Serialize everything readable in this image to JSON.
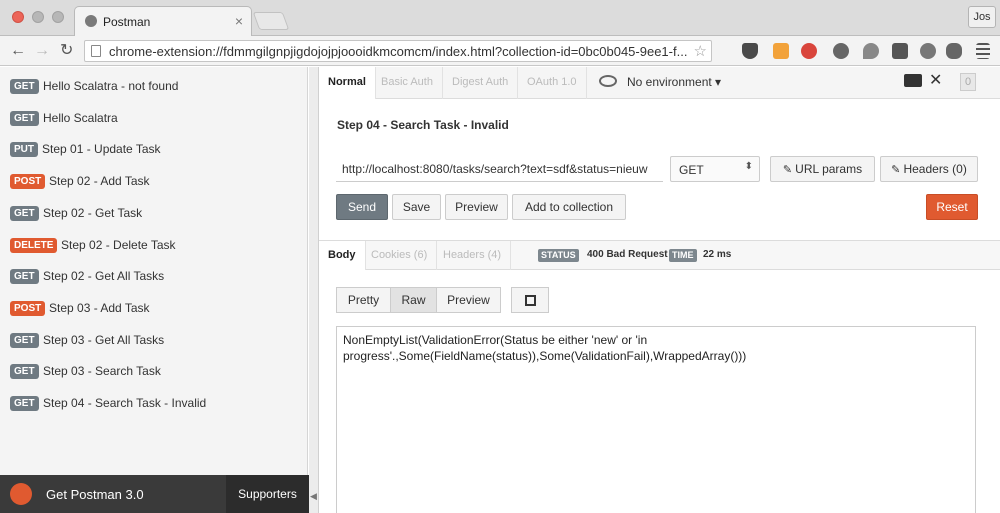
{
  "browser": {
    "tab_title": "Postman",
    "tab_close": "×",
    "profile": "Jos",
    "back": "←",
    "forward": "→",
    "reload": "↻",
    "url": "chrome-extension://fdmmgilgnpjigdojojpjoooidkmcomcm/index.html?collection-id=0bc0b045-9ee1-f...",
    "star": "☆",
    "extensions": [
      "pocket-icon",
      "extension-icon",
      "adblock-icon",
      "opera-icon",
      "location-icon",
      "angular-icon",
      "globe-icon",
      "twitter-icon",
      "menu-icon"
    ]
  },
  "sidebar": {
    "items": [
      {
        "method": "GET",
        "name": "Hello Scalatra - not found"
      },
      {
        "method": "GET",
        "name": "Hello Scalatra"
      },
      {
        "method": "PUT",
        "name": "Step 01 - Update Task"
      },
      {
        "method": "POST",
        "name": "Step 02 - Add Task"
      },
      {
        "method": "GET",
        "name": "Step 02 - Get Task"
      },
      {
        "method": "DELETE",
        "name": "Step 02 - Delete Task"
      },
      {
        "method": "GET",
        "name": "Step 02 - Get All Tasks"
      },
      {
        "method": "POST",
        "name": "Step 03 - Add Task"
      },
      {
        "method": "GET",
        "name": "Step 03 - Get All Tasks"
      },
      {
        "method": "GET",
        "name": "Step 03 - Search Task"
      },
      {
        "method": "GET",
        "name": "Step 04 - Search Task - Invalid"
      }
    ],
    "get_postman": "Get Postman 3.0",
    "supporters": "Supporters",
    "collapse_arrow": "◀"
  },
  "auth_tabs": [
    "Normal",
    "Basic Auth",
    "Digest Auth",
    "OAuth 1.0"
  ],
  "environment": "No environment ▾",
  "wrench": "✕",
  "notifications": "0",
  "request": {
    "title": "Step 04 - Search Task - Invalid",
    "url": "http://localhost:8080/tasks/search?text=sdf&status=nieuw",
    "method": "GET",
    "method_caret": "⬍",
    "url_params": "URL params",
    "headers": "Headers (0)",
    "send": "Send",
    "save": "Save",
    "preview": "Preview",
    "add_to_collection": "Add to collection",
    "reset": "Reset"
  },
  "response": {
    "tabs": [
      "Body",
      "Cookies (6)",
      "Headers (4)"
    ],
    "status_label": "STATUS",
    "status_value": "400 Bad Request",
    "time_label": "TIME",
    "time_value": "22 ms",
    "formats": [
      "Pretty",
      "Raw",
      "Preview"
    ],
    "body": "NonEmptyList(ValidationError(Status be either 'new' or 'in progress'.,Some(FieldName(status)),Some(ValidationFail),WrappedArray()))"
  },
  "colors": {
    "get_badge": "#6f7a82",
    "post_badge": "#e05a30",
    "reset": "#e05a30",
    "sidebar_bg": "#f4f4f4"
  }
}
